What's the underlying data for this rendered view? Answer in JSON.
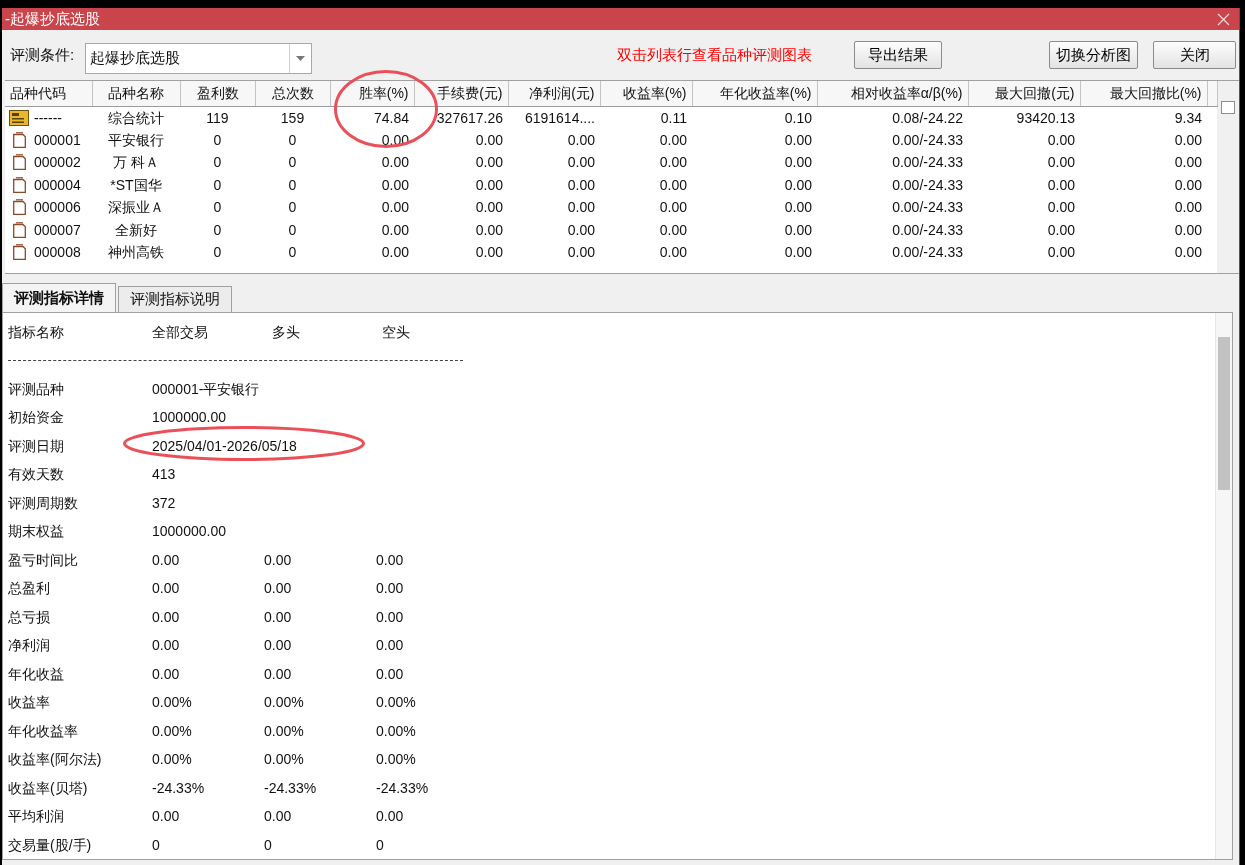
{
  "window": {
    "title": "-起爆抄底选股"
  },
  "toolbar": {
    "condition": {
      "label": "评测条件:",
      "value": "起爆抄底选股"
    },
    "hint": "双击列表行查看品种评测图表",
    "buttons": [
      "导出结果",
      "切换分析图",
      "关闭"
    ]
  },
  "table": {
    "columns": [
      {
        "label": "品种代码",
        "circled": false
      },
      {
        "label": "品种名称",
        "circled": false
      },
      {
        "label": "盈利数",
        "circled": false
      },
      {
        "label": "总次数",
        "circled": false
      },
      {
        "label": "胜率(%)",
        "circled": true
      },
      {
        "label": "手续费(元)",
        "circled": false
      },
      {
        "label": "净利润(元)",
        "circled": false
      },
      {
        "label": "收益率(%)",
        "circled": false
      },
      {
        "label": "年化收益率(%)",
        "circled": false
      },
      {
        "label": "相对收益率α/β(%)",
        "circled": false
      },
      {
        "label": "最大回撤(元)",
        "circled": false
      },
      {
        "label": "最大回撤比(%)",
        "circled": false
      }
    ],
    "rows": [
      {
        "kind": "summary",
        "cells": [
          "------",
          "综合统计",
          "119",
          "159",
          "74.84",
          "327617.26",
          "6191614....",
          "0.11",
          "0.10",
          "0.08/-24.22",
          "93420.13",
          "9.34"
        ]
      },
      {
        "kind": "stock",
        "cells": [
          "000001",
          "平安银行",
          "0",
          "0",
          "0.00",
          "0.00",
          "0.00",
          "0.00",
          "0.00",
          "0.00/-24.33",
          "0.00",
          "0.00"
        ]
      },
      {
        "kind": "stock",
        "cells": [
          "000002",
          "万 科Ａ",
          "0",
          "0",
          "0.00",
          "0.00",
          "0.00",
          "0.00",
          "0.00",
          "0.00/-24.33",
          "0.00",
          "0.00"
        ]
      },
      {
        "kind": "stock",
        "cells": [
          "000004",
          "*ST国华",
          "0",
          "0",
          "0.00",
          "0.00",
          "0.00",
          "0.00",
          "0.00",
          "0.00/-24.33",
          "0.00",
          "0.00"
        ]
      },
      {
        "kind": "stock",
        "cells": [
          "000006",
          "深振业Ａ",
          "0",
          "0",
          "0.00",
          "0.00",
          "0.00",
          "0.00",
          "0.00",
          "0.00/-24.33",
          "0.00",
          "0.00"
        ]
      },
      {
        "kind": "stock",
        "cells": [
          "000007",
          "全新好",
          "0",
          "0",
          "0.00",
          "0.00",
          "0.00",
          "0.00",
          "0.00",
          "0.00/-24.33",
          "0.00",
          "0.00"
        ]
      },
      {
        "kind": "stock",
        "cells": [
          "000008",
          "神州高铁",
          "0",
          "0",
          "0.00",
          "0.00",
          "0.00",
          "0.00",
          "0.00",
          "0.00/-24.33",
          "0.00",
          "0.00"
        ]
      }
    ],
    "corner_checkbox": {
      "checked": false
    }
  },
  "detail_tabs": [
    {
      "label": "评测指标详情",
      "selected": true
    },
    {
      "label": "评测指标说明",
      "selected": false
    }
  ],
  "details": {
    "header": [
      "指标名称",
      "全部交易",
      "多头",
      "空头"
    ],
    "rows": [
      {
        "label": "评测品种",
        "values": [
          "000001-平安银行"
        ],
        "circled": false
      },
      {
        "label": "初始资金",
        "values": [
          "1000000.00"
        ],
        "circled": false
      },
      {
        "label": "评测日期",
        "values": [
          "2025/04/01-2026/05/18"
        ],
        "circled": true
      },
      {
        "label": "有效天数",
        "values": [
          "413"
        ],
        "circled": false
      },
      {
        "label": "评测周期数",
        "values": [
          "372"
        ],
        "circled": false
      },
      {
        "label": "期末权益",
        "values": [
          "1000000.00"
        ],
        "circled": false
      },
      {
        "label": "盈亏时间比",
        "values": [
          "0.00",
          "0.00",
          "0.00"
        ],
        "circled": false
      },
      {
        "label": "总盈利",
        "values": [
          "0.00",
          "0.00",
          "0.00"
        ],
        "circled": false
      },
      {
        "label": "总亏损",
        "values": [
          "0.00",
          "0.00",
          "0.00"
        ],
        "circled": false
      },
      {
        "label": "净利润",
        "values": [
          "0.00",
          "0.00",
          "0.00"
        ],
        "circled": false
      },
      {
        "label": "年化收益",
        "values": [
          "0.00",
          "0.00",
          "0.00"
        ],
        "circled": false
      },
      {
        "label": "收益率",
        "values": [
          "0.00%",
          "0.00%",
          "0.00%"
        ],
        "circled": false
      },
      {
        "label": "年化收益率",
        "values": [
          "0.00%",
          "0.00%",
          "0.00%"
        ],
        "circled": false
      },
      {
        "label": "收益率(阿尔法)",
        "values": [
          "0.00%",
          "0.00%",
          "0.00%"
        ],
        "circled": false
      },
      {
        "label": "收益率(贝塔)",
        "values": [
          "-24.33%",
          "-24.33%",
          "-24.33%"
        ],
        "circled": false
      },
      {
        "label": "平均利润",
        "values": [
          "0.00",
          "0.00",
          "0.00"
        ],
        "circled": false
      },
      {
        "label": "交易量(股/手)",
        "values": [
          "0",
          "0",
          "0"
        ],
        "circled": false
      }
    ]
  }
}
